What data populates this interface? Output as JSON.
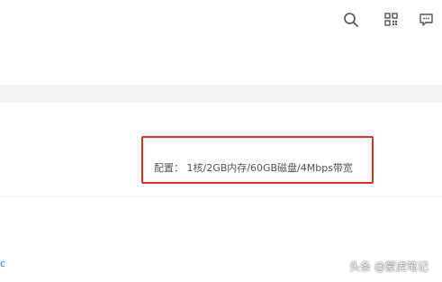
{
  "header": {
    "icons": [
      "search-icon",
      "grid-icon",
      "message-icon"
    ]
  },
  "panel": {
    "config_text": "配置： 1核/2GB内存/60GB磁盘/4Mbps带宽"
  },
  "edge_link": "c",
  "watermark": "头条 @蒙虎笔记",
  "colors": {
    "highlight": "#d9342b",
    "band": "#f2f3f5",
    "link": "#2f7de1"
  }
}
